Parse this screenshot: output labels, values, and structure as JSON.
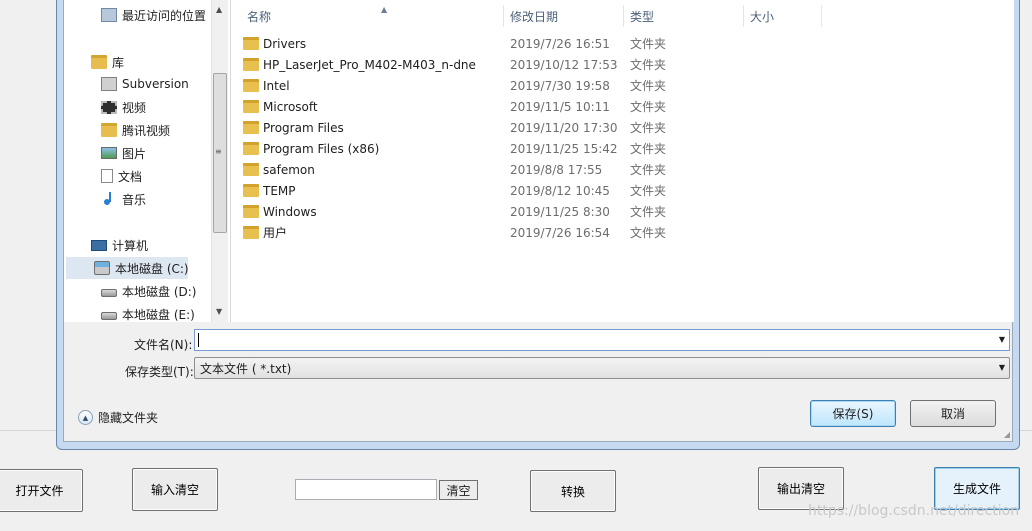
{
  "nav": {
    "items": [
      {
        "label": "最近访问的位置",
        "icon": "recent-places-icon"
      },
      {
        "label": "库",
        "icon": "libraries-icon"
      },
      {
        "label": "Subversion",
        "icon": "subversion-icon"
      },
      {
        "label": "视频",
        "icon": "videos-icon"
      },
      {
        "label": "腾讯视频",
        "icon": "folder-icon"
      },
      {
        "label": "图片",
        "icon": "pictures-icon"
      },
      {
        "label": "文档",
        "icon": "documents-icon"
      },
      {
        "label": "音乐",
        "icon": "music-icon"
      },
      {
        "label": "计算机",
        "icon": "computer-icon"
      },
      {
        "label": "本地磁盘 (C:)",
        "icon": "drive-icon",
        "selected": true
      },
      {
        "label": "本地磁盘 (D:)",
        "icon": "drive-icon"
      },
      {
        "label": "本地磁盘 (E:)",
        "icon": "drive-icon"
      }
    ]
  },
  "filelist": {
    "columns": [
      "名称",
      "修改日期",
      "类型",
      "大小"
    ],
    "rows": [
      {
        "name": "Drivers",
        "date": "2019/7/26 16:51",
        "type": "文件夹"
      },
      {
        "name": "HP_LaserJet_Pro_M402-M403_n-dne",
        "date": "2019/10/12 17:53",
        "type": "文件夹"
      },
      {
        "name": "Intel",
        "date": "2019/7/30 19:58",
        "type": "文件夹"
      },
      {
        "name": "Microsoft",
        "date": "2019/11/5 10:11",
        "type": "文件夹"
      },
      {
        "name": "Program Files",
        "date": "2019/11/20 17:30",
        "type": "文件夹"
      },
      {
        "name": "Program Files (x86)",
        "date": "2019/11/25 15:42",
        "type": "文件夹"
      },
      {
        "name": "safemon",
        "date": "2019/8/8 17:55",
        "type": "文件夹"
      },
      {
        "name": "TEMP",
        "date": "2019/8/12 10:45",
        "type": "文件夹"
      },
      {
        "name": "Windows",
        "date": "2019/11/25 8:30",
        "type": "文件夹"
      },
      {
        "name": "用户",
        "date": "2019/7/26 16:54",
        "type": "文件夹"
      }
    ]
  },
  "form": {
    "filename_label": "文件名(N):",
    "filename_value": "",
    "filetype_label": "保存类型(T):",
    "filetype_value": "文本文件 ( *.txt)",
    "save_label": "保存(S)",
    "cancel_label": "取消",
    "hide_folders_label": "隐藏文件夹"
  },
  "app": {
    "open_file": "打开文件",
    "input_clear": "输入清空",
    "input_value": "",
    "clear": "清空",
    "convert": "转换",
    "output_clear": "输出清空",
    "generate_file": "生成文件"
  },
  "watermark": "https://blog.csdn.net/direction"
}
